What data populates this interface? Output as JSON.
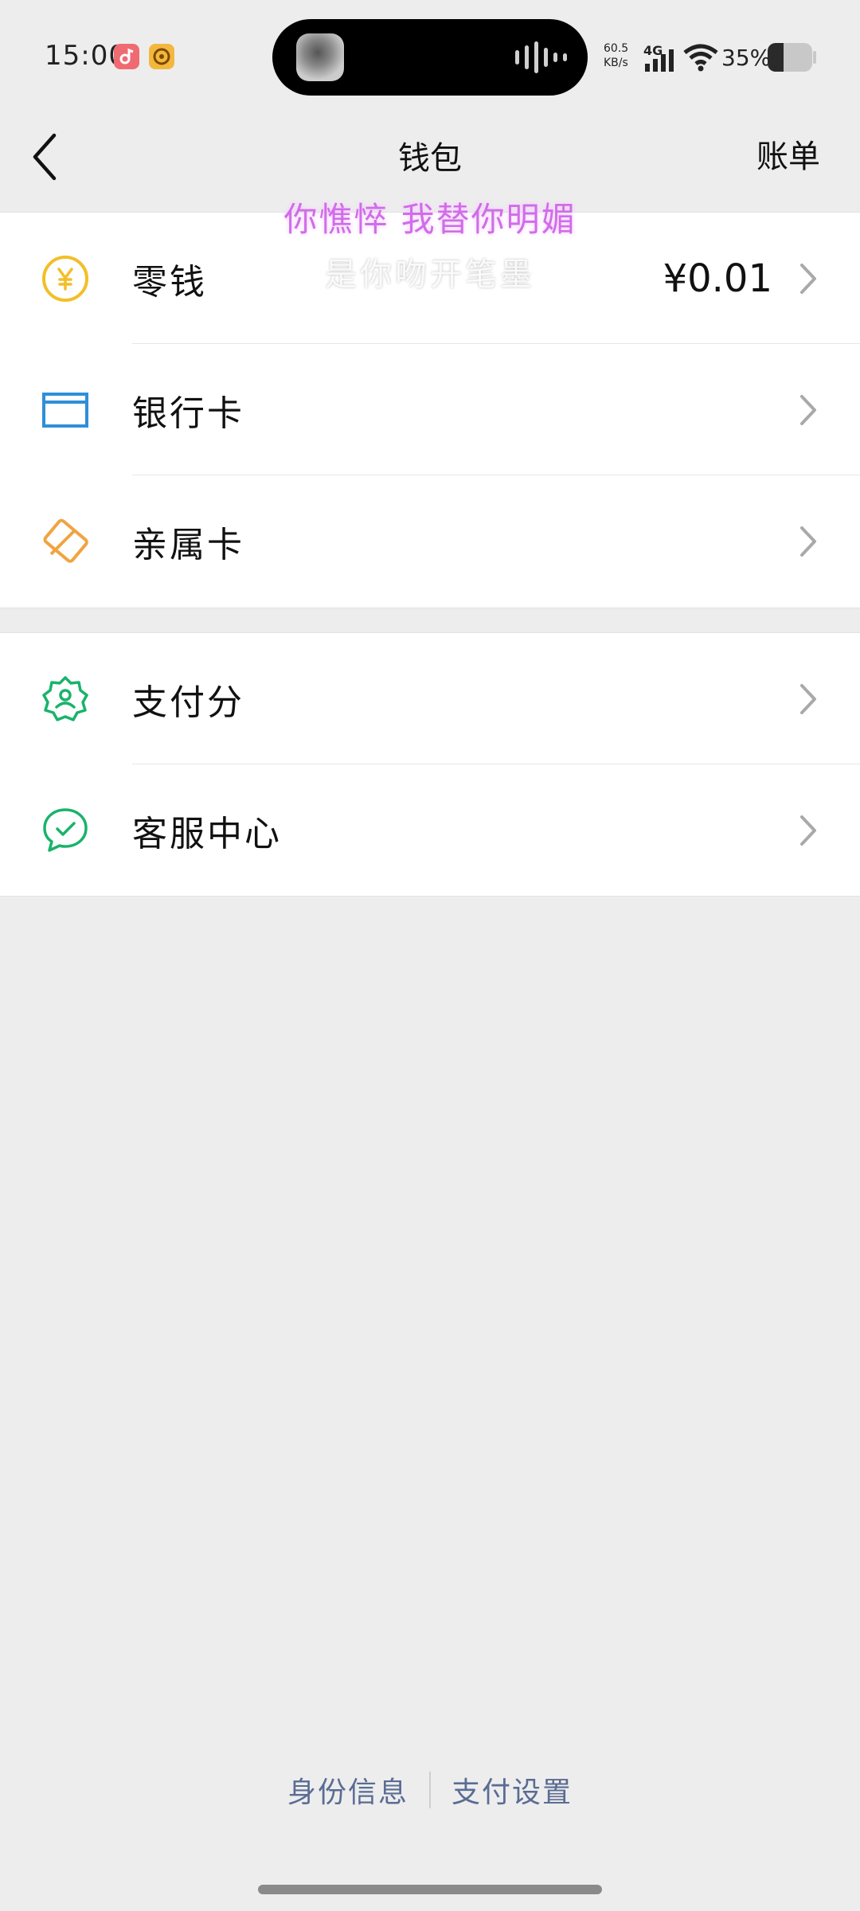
{
  "status_bar": {
    "time": "15:00",
    "net_speed_value": "60.5",
    "net_speed_unit": "KB/s",
    "network": "4G",
    "battery_percent": "35%",
    "battery_level": 0.35,
    "icons": [
      "music-app-icon",
      "media-app-icon",
      "signal-icon",
      "wifi-icon",
      "battery-icon"
    ]
  },
  "nav": {
    "title": "钱包",
    "right_action": "账单",
    "back_icon": "chevron-left-icon"
  },
  "lyrics": {
    "line1": "你憔悴 我替你明媚",
    "line2": "是你吻开笔墨"
  },
  "groups": [
    {
      "rows": [
        {
          "label": "零钱",
          "value": "¥0.01",
          "icon": "coin-yuan-icon",
          "icon_color": "#f2bf2a"
        },
        {
          "label": "银行卡",
          "value": "",
          "icon": "bank-card-icon",
          "icon_color": "#2f8fd8"
        },
        {
          "label": "亲属卡",
          "value": "",
          "icon": "family-card-icon",
          "icon_color": "#f0a440"
        }
      ]
    },
    {
      "rows": [
        {
          "label": "支付分",
          "value": "",
          "icon": "pay-score-badge-icon",
          "icon_color": "#19b36b"
        },
        {
          "label": "客服中心",
          "value": "",
          "icon": "customer-service-icon",
          "icon_color": "#19b36b"
        }
      ]
    }
  ],
  "footer": {
    "link_identity": "身份信息",
    "link_settings": "支付设置",
    "link_color": "#5a6c93"
  }
}
